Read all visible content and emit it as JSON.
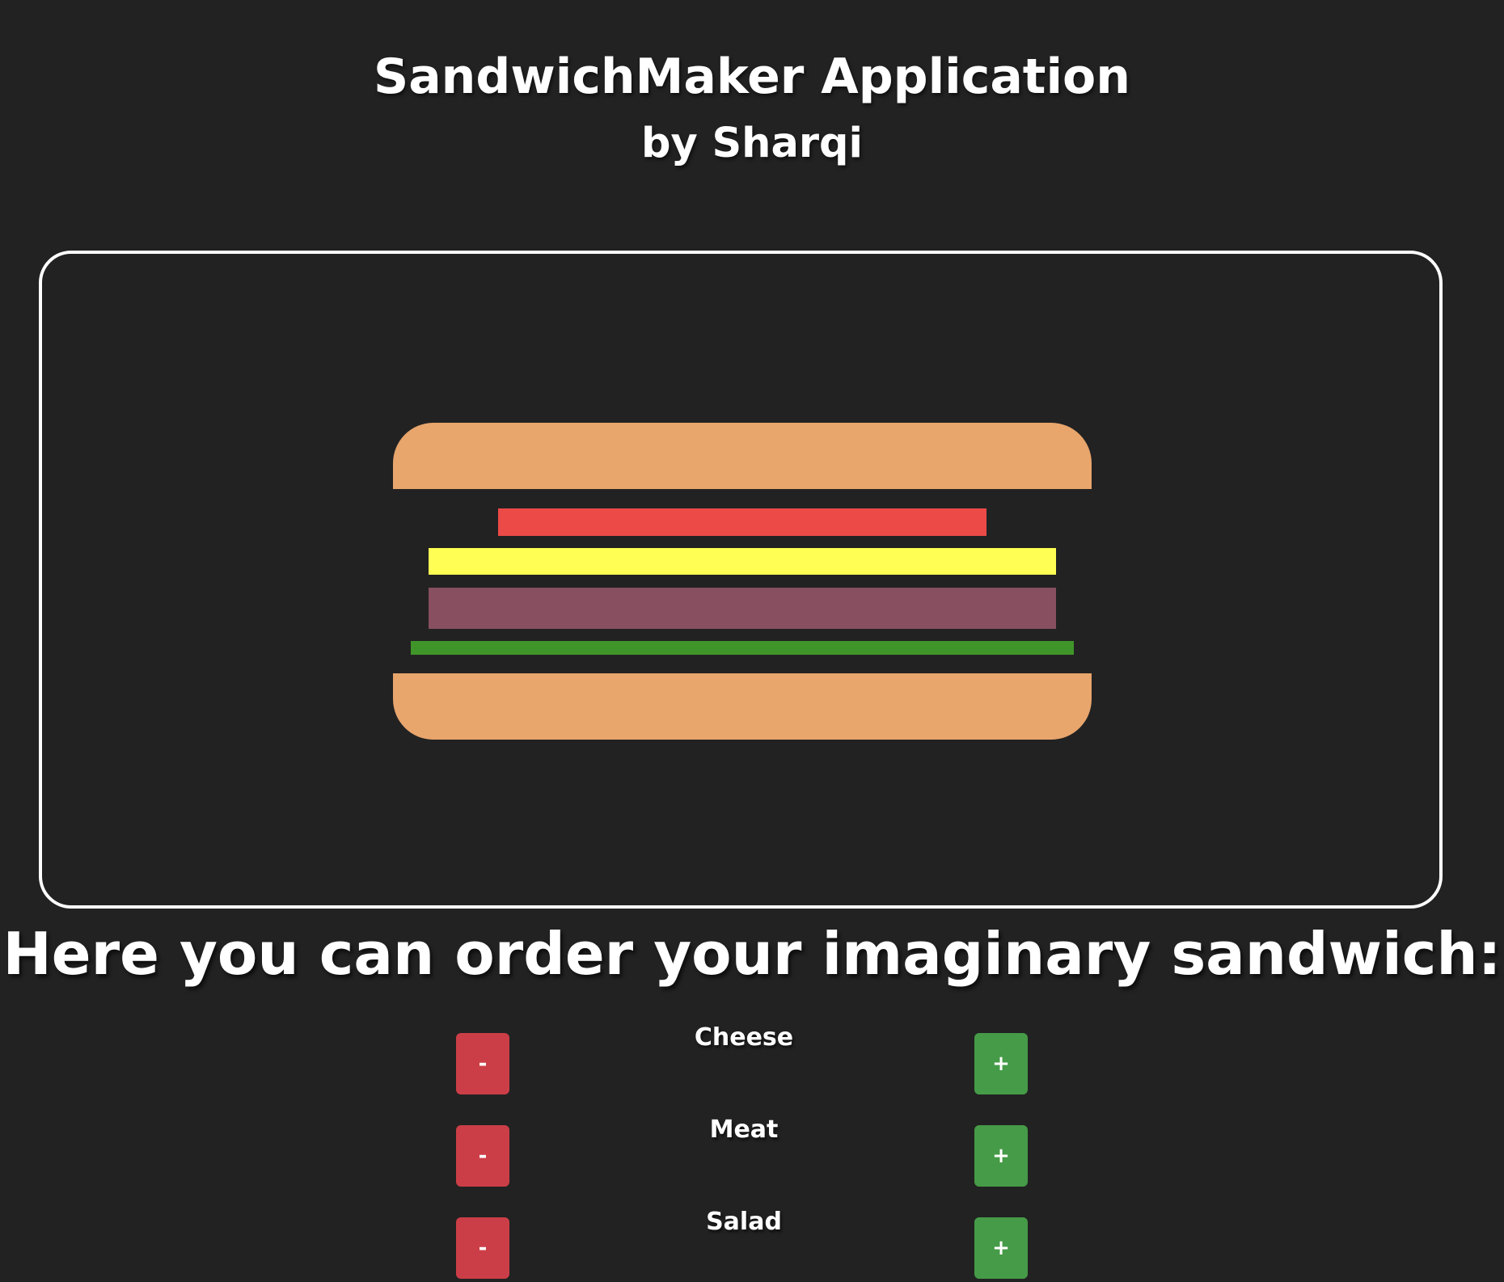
{
  "header": {
    "title": "SandwichMaker Application",
    "subtitle": "by Sharqi"
  },
  "sandwich": {
    "layers": [
      "bread-top",
      "tomato",
      "cheese",
      "meat",
      "salad",
      "bread-bottom"
    ],
    "colors": {
      "bread": "#e8a56c",
      "tomato": "#ec4a47",
      "cheese": "#fefe54",
      "meat": "#874f5f",
      "salad": "#40952a"
    }
  },
  "order": {
    "heading": "Here you can order your imaginary sandwich:",
    "controls": [
      {
        "label": "Cheese",
        "less": "-",
        "more": "+"
      },
      {
        "label": "Meat",
        "less": "-",
        "more": "+"
      },
      {
        "label": "Salad",
        "less": "-",
        "more": "+"
      }
    ]
  },
  "colors": {
    "background": "#222222",
    "less_button": "#cc3e47",
    "more_button": "#459b47",
    "text": "#ffffff"
  }
}
